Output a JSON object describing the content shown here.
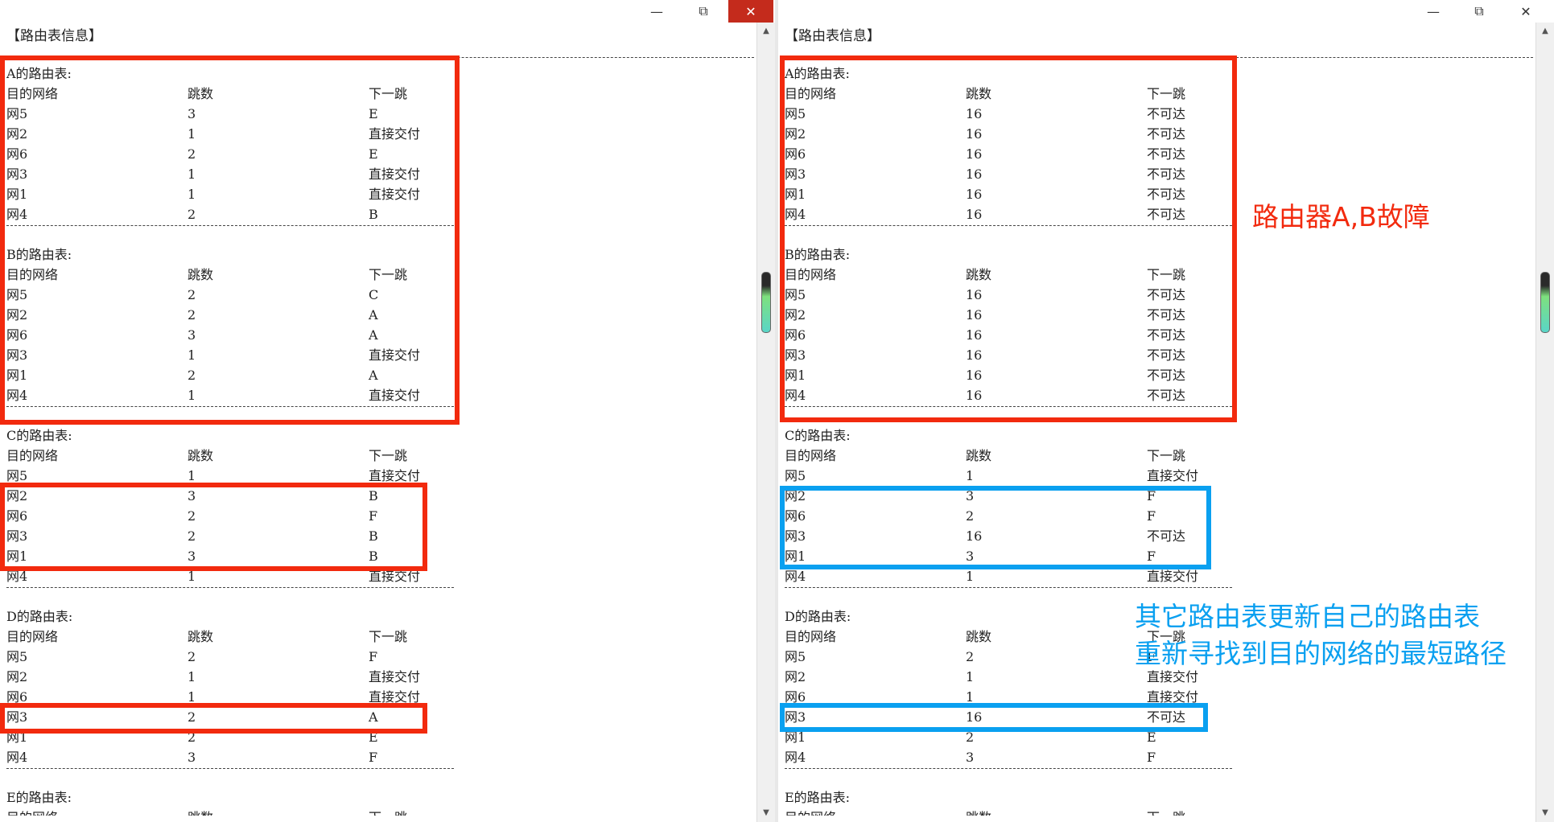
{
  "colors": {
    "highlight_red": "#f22a0e",
    "highlight_blue": "#0aa0f0",
    "annotation_red": "#f22a0e",
    "annotation_blue": "#0aa0f0",
    "close_hover": "#c42b1c"
  },
  "icons": {
    "minimize": "minimize-icon",
    "maximize": "restore-icon",
    "close": "close-icon"
  },
  "window_controls": {
    "minimize": "—",
    "maximize": "⧉",
    "close": "✕"
  },
  "scroll_arrows": {
    "up": "▲",
    "down": "▼"
  },
  "left": {
    "header": "【路由表信息】",
    "tables": [
      {
        "title": "A的路由表:",
        "columns": [
          "目的网络",
          "跳数",
          "下一跳"
        ],
        "rows": [
          [
            "网5",
            "3",
            "E"
          ],
          [
            "网2",
            "1",
            "直接交付"
          ],
          [
            "网6",
            "2",
            "E"
          ],
          [
            "网3",
            "1",
            "直接交付"
          ],
          [
            "网1",
            "1",
            "直接交付"
          ],
          [
            "网4",
            "2",
            "B"
          ]
        ]
      },
      {
        "title": "B的路由表:",
        "columns": [
          "目的网络",
          "跳数",
          "下一跳"
        ],
        "rows": [
          [
            "网5",
            "2",
            "C"
          ],
          [
            "网2",
            "2",
            "A"
          ],
          [
            "网6",
            "3",
            "A"
          ],
          [
            "网3",
            "1",
            "直接交付"
          ],
          [
            "网1",
            "2",
            "A"
          ],
          [
            "网4",
            "1",
            "直接交付"
          ]
        ]
      },
      {
        "title": "C的路由表:",
        "columns": [
          "目的网络",
          "跳数",
          "下一跳"
        ],
        "rows": [
          [
            "网5",
            "1",
            "直接交付"
          ],
          [
            "网2",
            "3",
            "B"
          ],
          [
            "网6",
            "2",
            "F"
          ],
          [
            "网3",
            "2",
            "B"
          ],
          [
            "网1",
            "3",
            "B"
          ],
          [
            "网4",
            "1",
            "直接交付"
          ]
        ]
      },
      {
        "title": "D的路由表:",
        "columns": [
          "目的网络",
          "跳数",
          "下一跳"
        ],
        "rows": [
          [
            "网5",
            "2",
            "F"
          ],
          [
            "网2",
            "1",
            "直接交付"
          ],
          [
            "网6",
            "1",
            "直接交付"
          ],
          [
            "网3",
            "2",
            "A"
          ],
          [
            "网1",
            "2",
            "E"
          ],
          [
            "网4",
            "3",
            "F"
          ]
        ]
      },
      {
        "title": "E的路由表:",
        "columns": [
          "目的网络",
          "跳数",
          "下一跳"
        ],
        "rows": []
      }
    ]
  },
  "right": {
    "header": "【路由表信息】",
    "tables": [
      {
        "title": "A的路由表:",
        "columns": [
          "目的网络",
          "跳数",
          "下一跳"
        ],
        "rows": [
          [
            "网5",
            "16",
            "不可达"
          ],
          [
            "网2",
            "16",
            "不可达"
          ],
          [
            "网6",
            "16",
            "不可达"
          ],
          [
            "网3",
            "16",
            "不可达"
          ],
          [
            "网1",
            "16",
            "不可达"
          ],
          [
            "网4",
            "16",
            "不可达"
          ]
        ]
      },
      {
        "title": "B的路由表:",
        "columns": [
          "目的网络",
          "跳数",
          "下一跳"
        ],
        "rows": [
          [
            "网5",
            "16",
            "不可达"
          ],
          [
            "网2",
            "16",
            "不可达"
          ],
          [
            "网6",
            "16",
            "不可达"
          ],
          [
            "网3",
            "16",
            "不可达"
          ],
          [
            "网1",
            "16",
            "不可达"
          ],
          [
            "网4",
            "16",
            "不可达"
          ]
        ]
      },
      {
        "title": "C的路由表:",
        "columns": [
          "目的网络",
          "跳数",
          "下一跳"
        ],
        "rows": [
          [
            "网5",
            "1",
            "直接交付"
          ],
          [
            "网2",
            "3",
            "F"
          ],
          [
            "网6",
            "2",
            "F"
          ],
          [
            "网3",
            "16",
            "不可达"
          ],
          [
            "网1",
            "3",
            "F"
          ],
          [
            "网4",
            "1",
            "直接交付"
          ]
        ]
      },
      {
        "title": "D的路由表:",
        "columns": [
          "目的网络",
          "跳数",
          "下一跳"
        ],
        "rows": [
          [
            "网5",
            "2",
            "F"
          ],
          [
            "网2",
            "1",
            "直接交付"
          ],
          [
            "网6",
            "1",
            "直接交付"
          ],
          [
            "网3",
            "16",
            "不可达"
          ],
          [
            "网1",
            "2",
            "E"
          ],
          [
            "网4",
            "3",
            "F"
          ]
        ]
      },
      {
        "title": "E的路由表:",
        "columns": [
          "目的网络",
          "跳数",
          "下一跳"
        ],
        "rows": []
      }
    ]
  },
  "annotations": {
    "failure": "路由器A,B故障",
    "update_line1": "其它路由表更新自己的路由表",
    "update_line2": "重新寻找到目的网络的最短路径"
  }
}
